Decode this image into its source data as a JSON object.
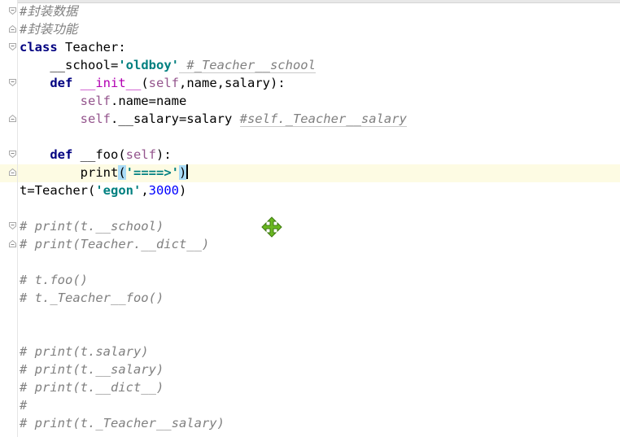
{
  "editor": {
    "lines": {
      "l1": "#封装数据",
      "l2": "#封装功能",
      "l3_kw": "class",
      "l3_name": " Teacher:",
      "l4_a": "    __school=",
      "l4_str": "'oldboy'",
      "l4_com": " #_Teacher__school",
      "l5_kw": "    def",
      "l5_name": " __init__",
      "l5_p1": "(",
      "l5_self": "self",
      "l5_rest": ",name,salary):",
      "l6_self": "        self",
      "l6_rest": ".name=name",
      "l7_self": "        self",
      "l7_rest": ".__salary=salary ",
      "l7_com": "#self._Teacher__salary",
      "l9_kw": "    def",
      "l9_name": " __foo(",
      "l9_self": "self",
      "l9_rest": "):",
      "l10_a": "        print",
      "l10_open": "(",
      "l10_str": "'====>'",
      "l10_close": ")",
      "l11_a": "t=Teacher(",
      "l11_str": "'egon'",
      "l11_b": ",",
      "l11_num": "3000",
      "l11_c": ")",
      "l13": "# print(t.__school)",
      "l14": "# print(Teacher.__dict__)",
      "l16": "# t.foo()",
      "l17": "# t._Teacher__foo()",
      "l20": "# print(t.salary)",
      "l21": "# print(t.__salary)",
      "l22": "# print(t.__dict__)",
      "l23": "#",
      "l24": "# print(t._Teacher__salary)"
    }
  },
  "icons": {
    "fold_marker": "fold-marker-icon",
    "move_cursor": "move-cursor-icon"
  },
  "colors": {
    "keyword": "#000080",
    "string": "#008080",
    "number": "#0000ff",
    "self": "#94558d",
    "comment": "#808080",
    "caret_line": "#fdfbe3",
    "move_cursor": "#6ab820"
  }
}
